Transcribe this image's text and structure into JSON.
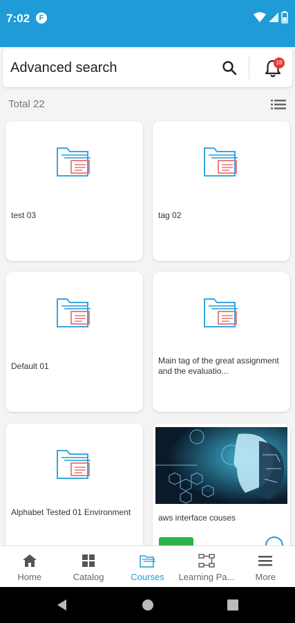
{
  "status": {
    "time": "7:02",
    "app_icon_letter": "F"
  },
  "header": {
    "title": "Advanced search",
    "notification_count": "18"
  },
  "results": {
    "total_label": "Total 22"
  },
  "cards": [
    {
      "title": "test 03"
    },
    {
      "title": "tag 02"
    },
    {
      "title": "Default 01"
    },
    {
      "title": "Main tag of the great assignment and the evaluatio..."
    },
    {
      "title": "Alphabet Tested 01 Environment"
    },
    {
      "title": "aws interface couses"
    }
  ],
  "nav": {
    "items": [
      {
        "label": "Home",
        "icon": "home-icon"
      },
      {
        "label": "Catalog",
        "icon": "catalog-icon"
      },
      {
        "label": "Courses",
        "icon": "courses-icon",
        "active": true
      },
      {
        "label": "Learning Pa...",
        "icon": "learning-path-icon"
      },
      {
        "label": "More",
        "icon": "menu-icon"
      }
    ]
  },
  "colors": {
    "primary": "#1f9bd7",
    "badge": "#e53935",
    "folder_red": "#e57373",
    "tag_green": "#2bb24c"
  }
}
